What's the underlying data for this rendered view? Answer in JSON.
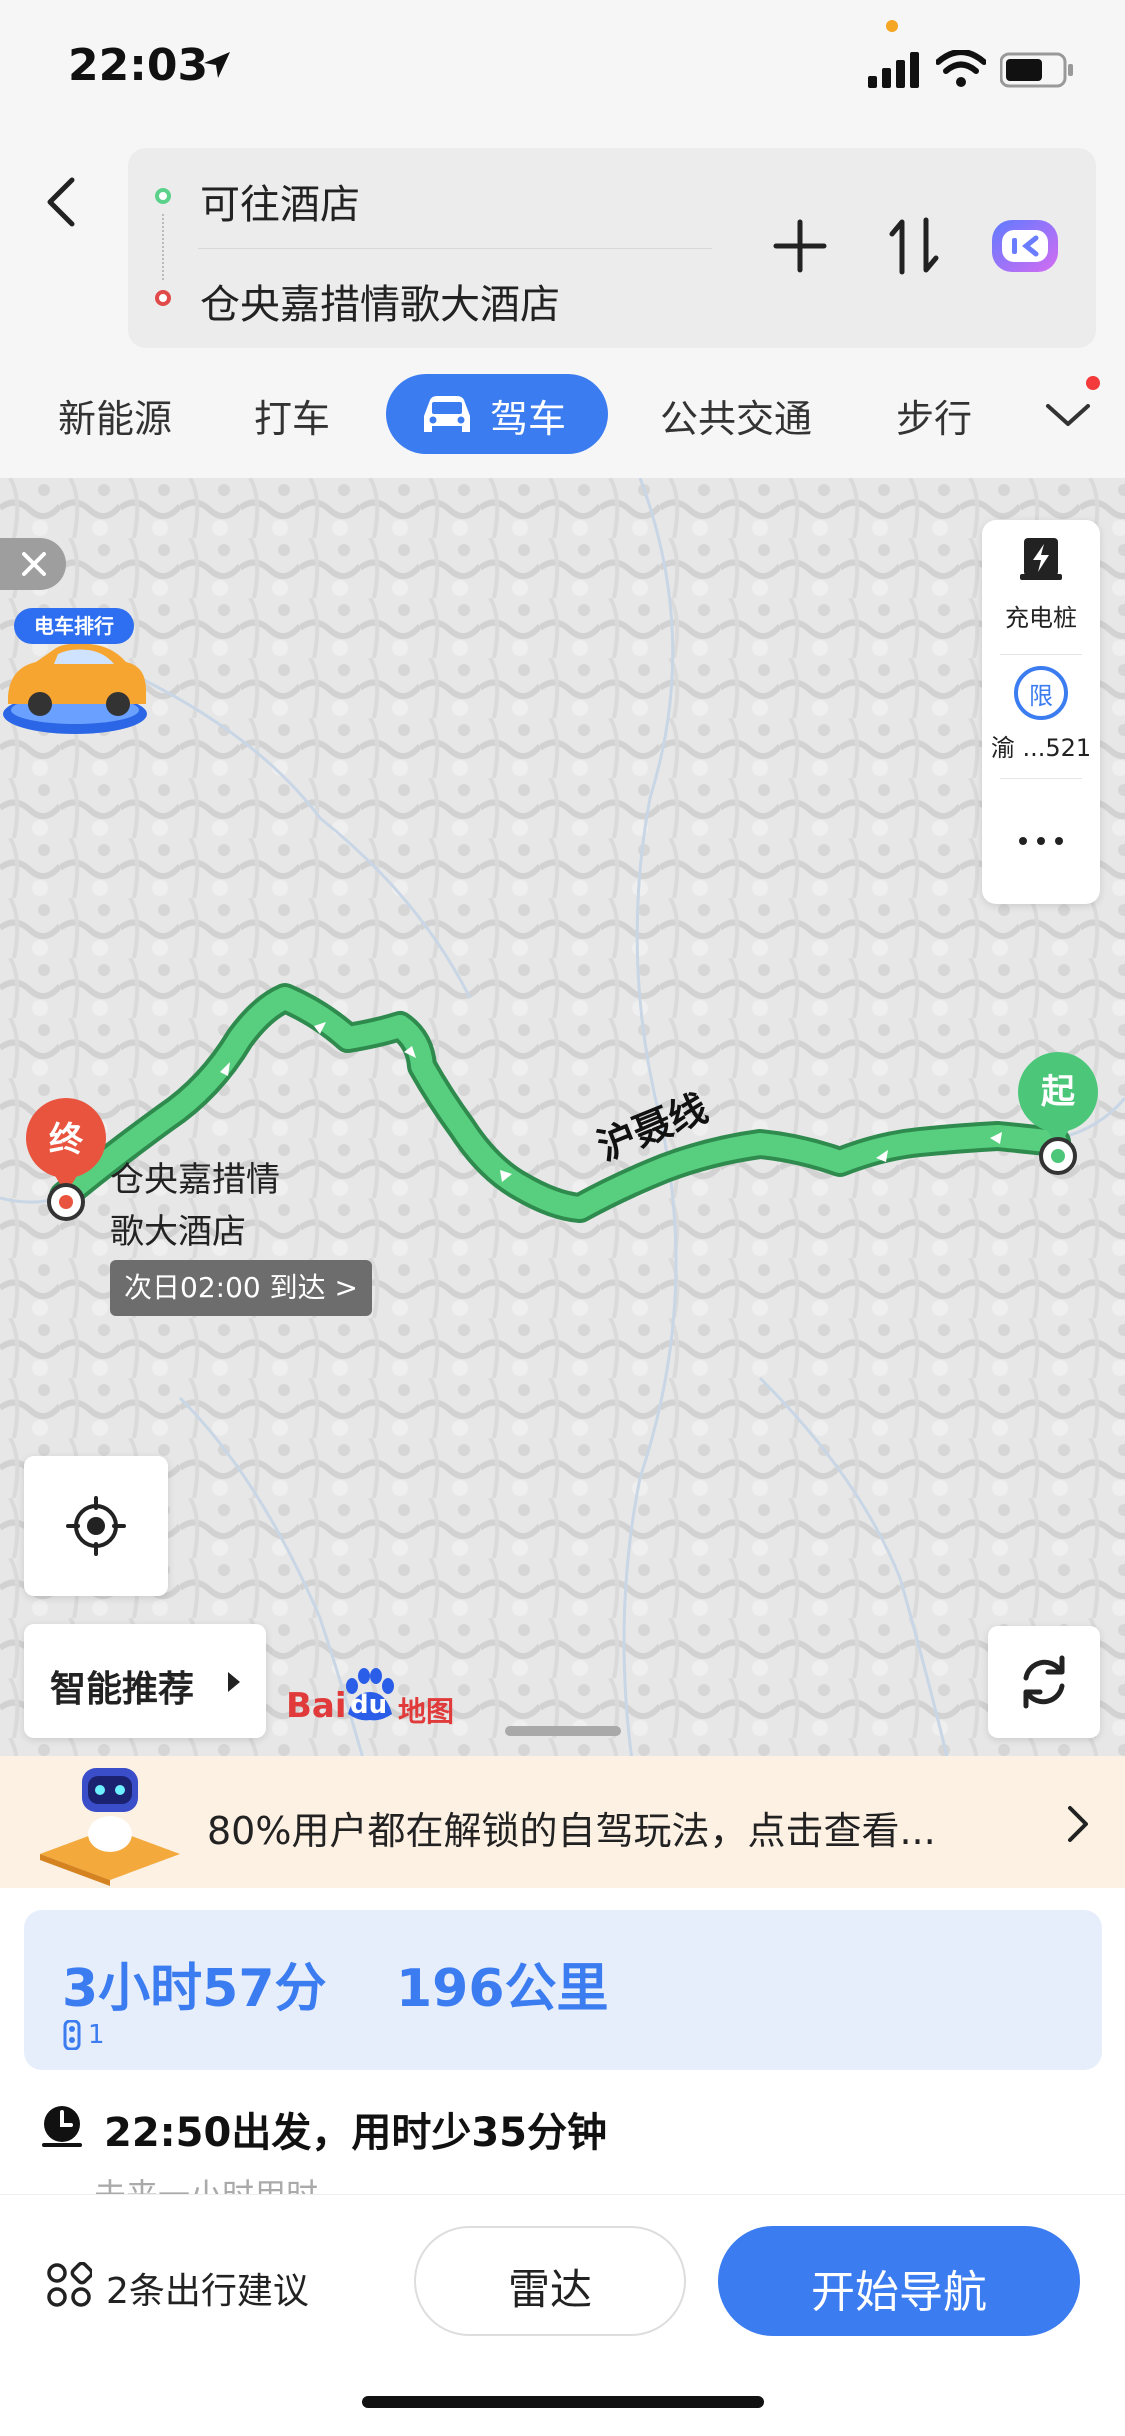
{
  "status_bar": {
    "time": "22:03"
  },
  "route": {
    "from": "可往酒店",
    "to": "仓央嘉措情歌大酒店"
  },
  "tabs": [
    {
      "label": "新能源"
    },
    {
      "label": "打车"
    },
    {
      "label": "驾车",
      "active": true
    },
    {
      "label": "公共交通"
    },
    {
      "label": "步行"
    }
  ],
  "map": {
    "side_panel": {
      "charging": "充电桩",
      "restriction_badge": "限",
      "restriction": "渝 ...521"
    },
    "promo_badge": "电车排行",
    "start_pin": "起",
    "end_pin": "终",
    "road_name": "沪聂线",
    "end_name_line1": "仓央嘉措情",
    "end_name_line2": "歌大酒店",
    "eta": "次日02:00 到达 >",
    "smart_recommend": "智能推荐",
    "logo_bai": "Bai",
    "logo_du": "du",
    "logo_map": "地图"
  },
  "banner": {
    "text": "80%用户都在解锁的自驾玩法，点击查看..."
  },
  "route_summary": {
    "duration": "3小时57分",
    "distance": "196公里",
    "traffic_lights": "1",
    "departure": "22:50出发，用时少35分钟",
    "departure_sub": "未来一小时用时"
  },
  "bottom": {
    "tips": "2条出行建议",
    "radar": "雷达",
    "navigate": "开始导航"
  },
  "colors": {
    "accent": "#3b7cf0",
    "route_green": "#4cc77a",
    "start_green": "#4cc77a",
    "end_red": "#e8543e"
  }
}
